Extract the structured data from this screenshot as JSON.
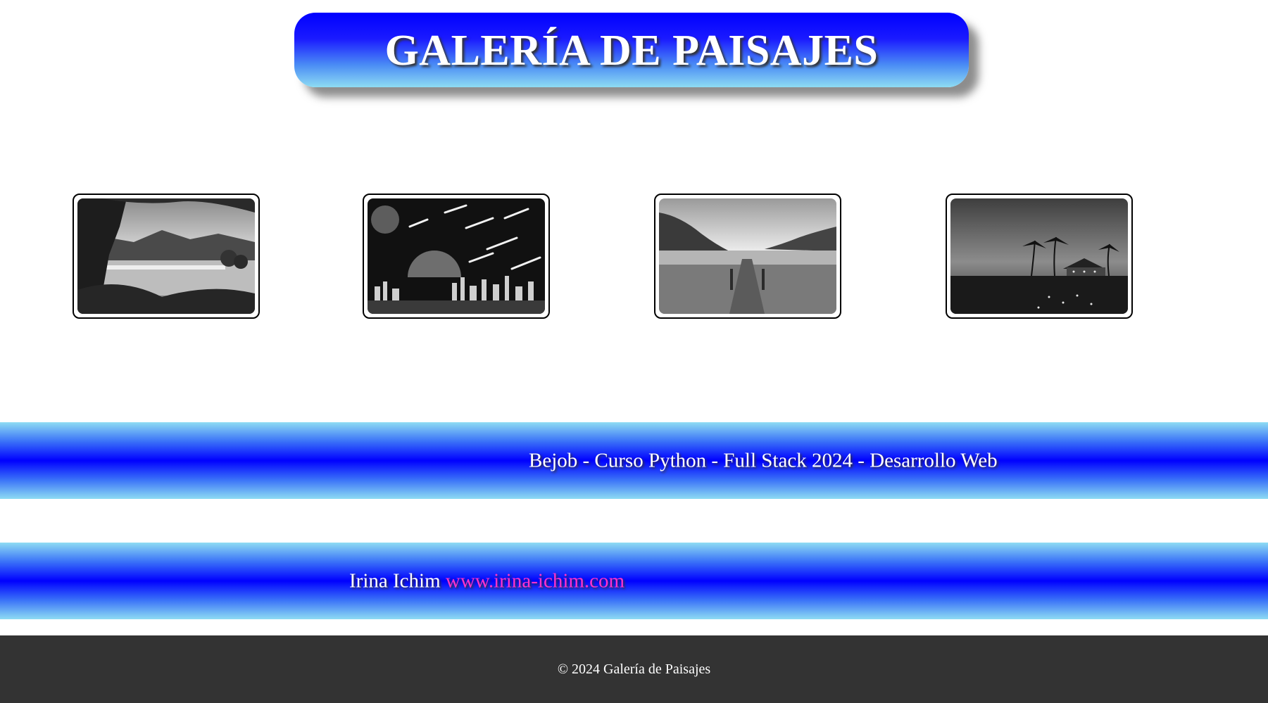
{
  "header": {
    "title": "GALERÍA DE PAISAJES",
    "gradient_top": "#0000ff",
    "gradient_bottom": "#8edcf3"
  },
  "gallery": {
    "images": [
      {
        "name": "lake-with-trees",
        "style": "grayscale"
      },
      {
        "name": "meteor-city-skyline",
        "style": "grayscale"
      },
      {
        "name": "wooden-pier-sea",
        "style": "grayscale"
      },
      {
        "name": "tropical-resort-night",
        "style": "grayscale"
      }
    ]
  },
  "banner_course": {
    "text": "Bejob - Curso Python - Full Stack 2024 - Desarrollo Web"
  },
  "banner_author": {
    "name": "Irina Ichim",
    "link_text": "www.irina-ichim.com",
    "link_color": "#ff33cc"
  },
  "footer": {
    "text": "© 2024 Galería de Paisajes",
    "background": "#333333"
  }
}
